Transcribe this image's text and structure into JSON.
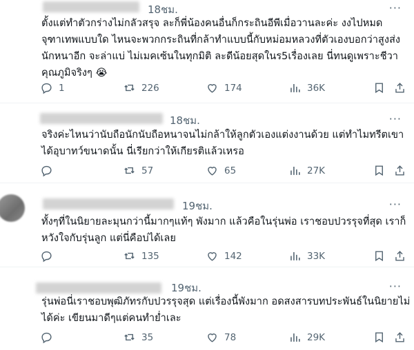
{
  "tweets": [
    {
      "time": "18ชม.",
      "more": "···",
      "lines": [
        "ตั้งแต่ทำตัวกร่างไม่กลัวสรุจ ละก็พี่น้องคนอื่นก็กระถินอีพีเมื่อวานละค่ะ งงไปหมด",
        "จุฑาเทพแบบใด ไหนจะพวกกระถินที่กล้าทำแบบนี้กับหม่อมหลวงที่ตัวเองบอกว่าสูงส่ง",
        "นักหนาอีก  จะล่าแบ่ ไม่เมคเซ้นในทุกมิติ ละดีน้อยสุดในร5เรื่องเลย นี่ทนดูเพราะชีวา",
        "คุณภูมิจริงๆ 😭"
      ],
      "replies": "1",
      "reposts": "226",
      "likes": "174",
      "views": "36K"
    },
    {
      "time": "18ชม.",
      "more": "···",
      "lines": [
        "จริงค่ะไหนว่านับถือนักนับถือหนาจนไม่กล้าให้ลูกตัวเองแต่งงานด้วย แต่ทำไมทรีตเขา",
        "ได้อุบาทว์ขนาดนั้น นี่เรียกว่าให้เกียรติแล้วเหรอ"
      ],
      "replies": "",
      "reposts": "57",
      "likes": "65",
      "views": "27K"
    },
    {
      "time": "19ชม.",
      "more": "···",
      "lines": [
        "ทั้งๆที่ในนิยายละมุนกว่านี้มากๆแท้ๆ พังมาก แล้วคือในรุ่นพ่อ เราชอบปวรรุจที่สุด เราก็",
        "หวังใจกับรุ่นลูก แต่นี่คือบ่ได้เลย"
      ],
      "replies": "",
      "reposts": "135",
      "likes": "142",
      "views": "33K"
    },
    {
      "time": "19ชม.",
      "more": "···",
      "lines": [
        "รุ่นพ่อนี่เราชอบพุฒิภัทรกับปวรรุจสุด แต่เรื่องนี้พังมาก อดสงสารบทประพันธ์ในนิยายไม่",
        "ได้ค่ะ เขียนมาดีๆแต่คนทำย่ำเละ"
      ],
      "replies": "",
      "reposts": "35",
      "likes": "78",
      "views": "29K"
    }
  ],
  "icons": {
    "reply": "reply-icon",
    "repost": "repost-icon",
    "like": "like-icon",
    "views": "views-icon",
    "bookmark": "bookmark-icon",
    "share": "share-icon"
  },
  "colors": {
    "text": "#0f1419",
    "muted": "#536471",
    "divider": "#eff3f4"
  }
}
